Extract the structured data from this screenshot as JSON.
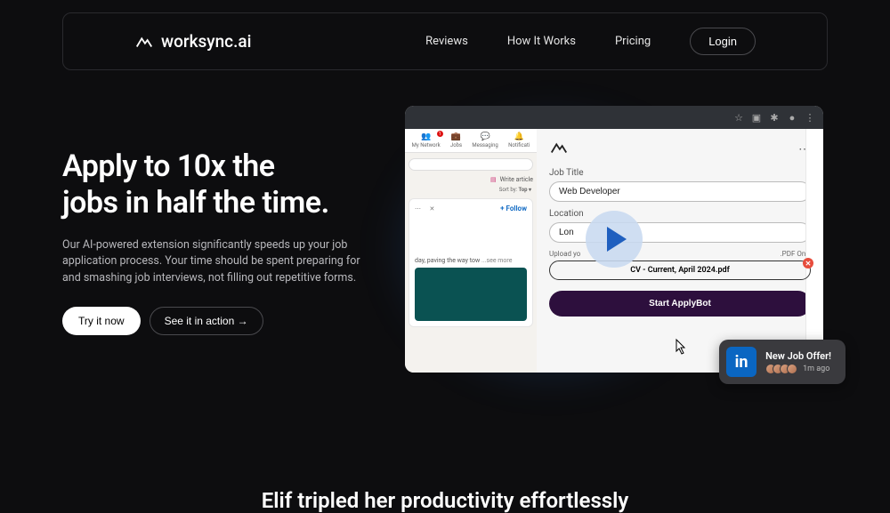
{
  "brand": "worksync.ai",
  "nav": {
    "reviews": "Reviews",
    "howitworks": "How It Works",
    "pricing": "Pricing",
    "login": "Login"
  },
  "hero": {
    "title_line1": "Apply to 10x the",
    "title_line2": "jobs in half the time.",
    "desc": "Our AI-powered extension significantly speeds up your job application process. Your time should be spent preparing for and smashing job interviews, not filling out repetitive forms.",
    "try": "Try it now",
    "see": "See it in action →"
  },
  "mock": {
    "linkedin": {
      "tab_network": "My Network",
      "tab_jobs": "Jobs",
      "tab_messaging": "Messaging",
      "tab_notifications": "Notificati",
      "write_article": "Write article",
      "sort_by": "Sort by:",
      "sort_value": "Top ▾",
      "follow": "+ Follow",
      "post_tail": "day, paving the way tow",
      "see_more": "...see more"
    },
    "ext": {
      "job_title_label": "Job Title",
      "job_title_value": "Web Developer",
      "location_label": "Location",
      "location_value": "Lon",
      "upload_label": "Upload yo",
      "upload_hint": ".PDF Only",
      "cv_name": "CV - Current, April 2024.pdf",
      "start_btn": "Start ApplyBot"
    }
  },
  "notification": {
    "title": "New Job Offer!",
    "time": "1m ago"
  },
  "teaser": "Elif tripled her productivity effortlessly"
}
